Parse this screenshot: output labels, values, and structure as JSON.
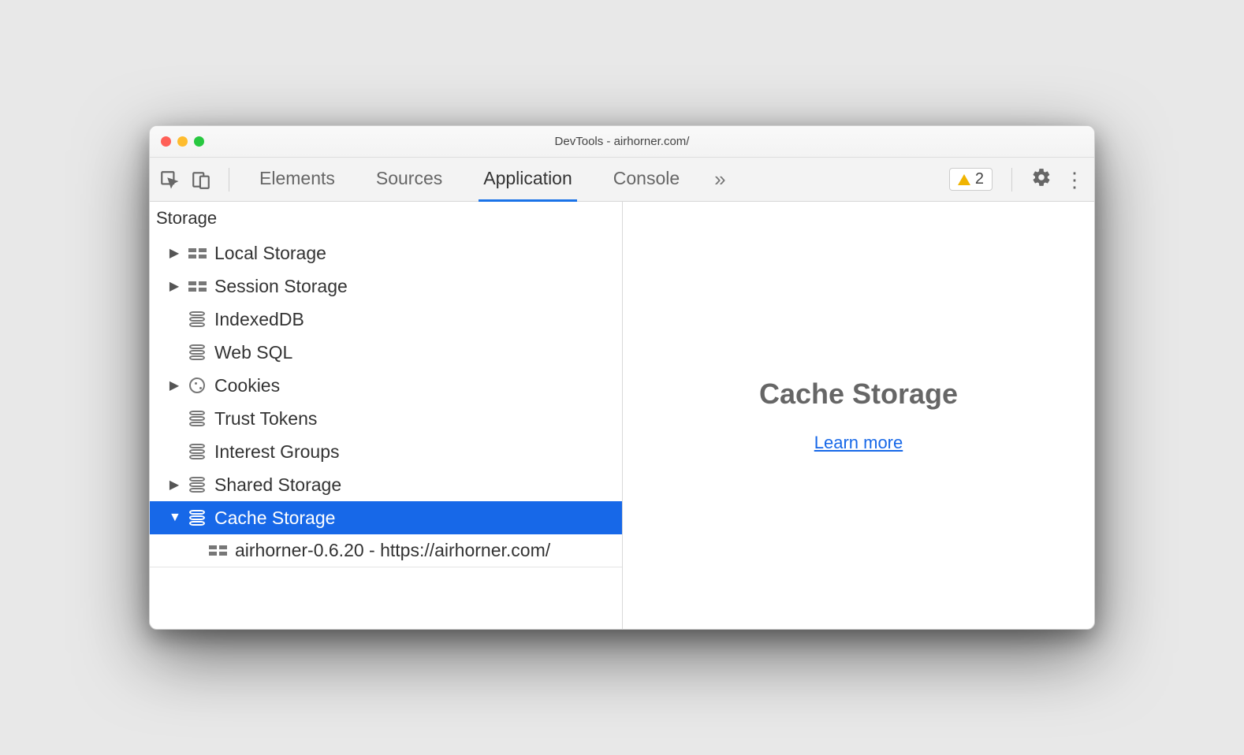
{
  "window": {
    "title": "DevTools - airhorner.com/"
  },
  "toolbar": {
    "tabs": {
      "elements": "Elements",
      "sources": "Sources",
      "application": "Application",
      "console": "Console"
    },
    "warning_count": "2"
  },
  "sidebar": {
    "section": "Storage",
    "items": {
      "local_storage": "Local Storage",
      "session_storage": "Session Storage",
      "indexeddb": "IndexedDB",
      "websql": "Web SQL",
      "cookies": "Cookies",
      "trust_tokens": "Trust Tokens",
      "interest_groups": "Interest Groups",
      "shared_storage": "Shared Storage",
      "cache_storage": "Cache Storage",
      "cache_child": "airhorner-0.6.20 - https://airhorner.com/"
    }
  },
  "main": {
    "heading": "Cache Storage",
    "link": "Learn more"
  }
}
